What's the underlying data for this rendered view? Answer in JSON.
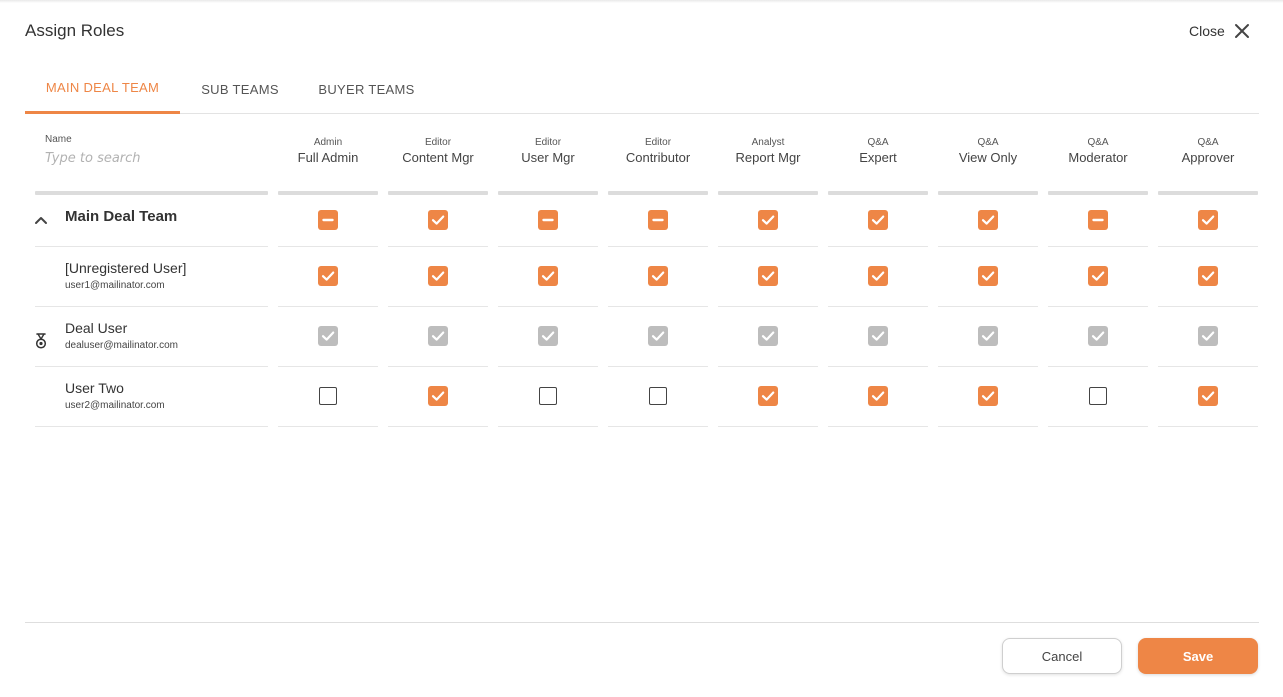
{
  "dialog": {
    "title": "Assign Roles",
    "close_label": "Close"
  },
  "tabs": [
    {
      "label": "MAIN DEAL TEAM",
      "active": true
    },
    {
      "label": "SUB TEAMS",
      "active": false
    },
    {
      "label": "BUYER TEAMS",
      "active": false
    }
  ],
  "name_column": {
    "label": "Name",
    "placeholder": "Type to search",
    "value": ""
  },
  "roles": [
    {
      "category": "Admin",
      "name": "Full Admin"
    },
    {
      "category": "Editor",
      "name": "Content Mgr"
    },
    {
      "category": "Editor",
      "name": "User Mgr"
    },
    {
      "category": "Editor",
      "name": "Contributor"
    },
    {
      "category": "Analyst",
      "name": "Report Mgr"
    },
    {
      "category": "Q&A",
      "name": "Expert"
    },
    {
      "category": "Q&A",
      "name": "View Only"
    },
    {
      "category": "Q&A",
      "name": "Moderator"
    },
    {
      "category": "Q&A",
      "name": "Approver"
    }
  ],
  "group": {
    "label": "Main Deal Team",
    "expanded": true,
    "states": [
      "partial",
      "checked",
      "partial",
      "partial",
      "checked",
      "checked",
      "checked",
      "partial",
      "checked"
    ]
  },
  "users": [
    {
      "name": "[Unregistered User]",
      "email": "user1@mailinator.com",
      "icon": "",
      "states": [
        "checked",
        "checked",
        "checked",
        "checked",
        "checked",
        "checked",
        "checked",
        "checked",
        "checked"
      ]
    },
    {
      "name": "Deal User",
      "email": "dealuser@mailinator.com",
      "icon": "badge-icon",
      "states": [
        "disabled",
        "disabled",
        "disabled",
        "disabled",
        "disabled",
        "disabled",
        "disabled",
        "disabled",
        "disabled"
      ]
    },
    {
      "name": "User Two",
      "email": "user2@mailinator.com",
      "icon": "",
      "states": [
        "unchecked",
        "checked",
        "unchecked",
        "unchecked",
        "checked",
        "checked",
        "checked",
        "unchecked",
        "checked"
      ]
    }
  ],
  "footer": {
    "cancel_label": "Cancel",
    "save_label": "Save"
  },
  "colors": {
    "accent": "#ee8646",
    "disabled": "#bdbdbd",
    "divider": "#e6e6e6"
  }
}
